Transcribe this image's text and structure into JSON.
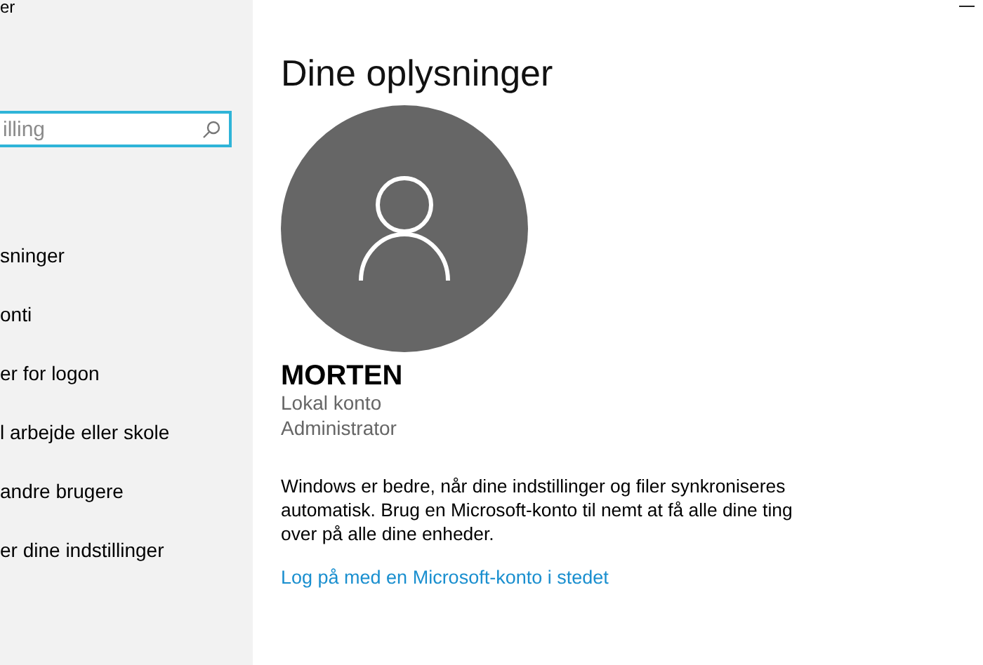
{
  "window": {
    "title": "er"
  },
  "sidebar": {
    "search": {
      "placeholder": "illing",
      "focused": true
    },
    "items": [
      {
        "label": "sninger",
        "selected": false
      },
      {
        "label": "onti",
        "selected": false
      },
      {
        "label": "er for logon",
        "selected": false
      },
      {
        "label": "l arbejde eller skole",
        "selected": false
      },
      {
        "label": "andre brugere",
        "selected": false
      },
      {
        "label": "er dine indstillinger",
        "selected": false
      }
    ]
  },
  "main": {
    "heading": "Dine oplysninger",
    "user": {
      "name": "MORTEN",
      "account_type": "Lokal konto",
      "role": "Administrator"
    },
    "description": "Windows er bedre, når dine indstillinger og filer synkroniseres automatisk. Brug en Microsoft-konto til nemt at få alle dine ting over på alle dine enheder.",
    "link": "Log på med en Microsoft-konto i stedet"
  }
}
